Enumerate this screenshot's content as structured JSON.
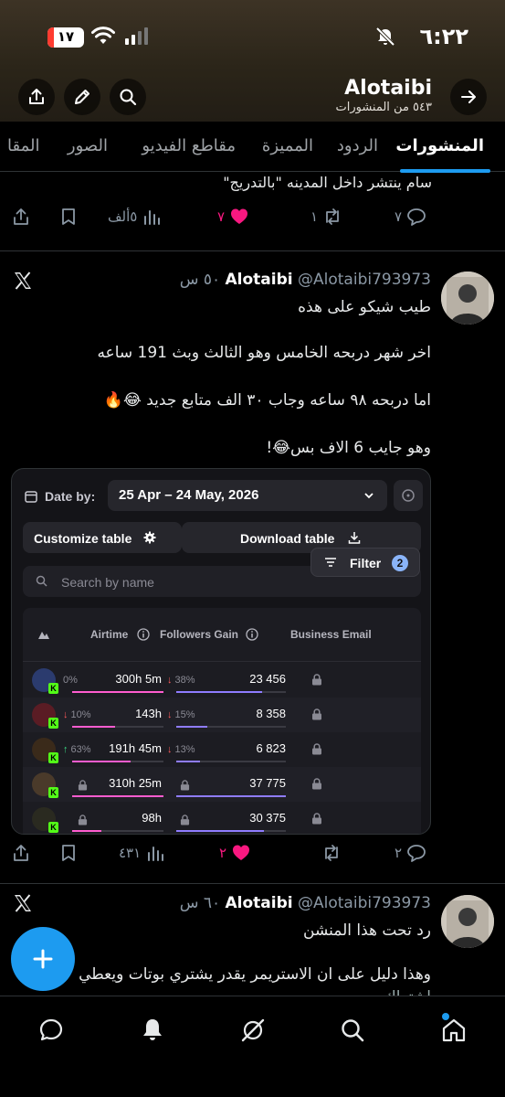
{
  "status_bar": {
    "time": "٦:٢٢",
    "battery_level": "١٧",
    "battery_fraction": 0.17
  },
  "profile": {
    "name": "Alotaibi",
    "post_count": "٥٤٣ من المنشورات"
  },
  "tabs": [
    {
      "label": "المنشورات",
      "active": true
    },
    {
      "label": "الردود",
      "active": false
    },
    {
      "label": "المميزة",
      "active": false
    },
    {
      "label": "مقاطع الفيديو",
      "active": false
    },
    {
      "label": "الصور",
      "active": false
    },
    {
      "label": "المقا",
      "active": false
    }
  ],
  "previous_post": {
    "tail_text": "سام ينتشر داخل المدينه \"بالتدريج\"",
    "replies": "٧",
    "reposts": "١",
    "likes": "٧",
    "views": "٥ألف"
  },
  "post1": {
    "author_name": "Alotaibi",
    "handle_time": "@Alotaibi793973 ٥٠ س",
    "lines": [
      "طيب شيكو على هذه",
      "اخر شهر دربحه الخامس وهو الثالث وبث 191 ساعه",
      "اما دربحه ٩٨ ساعه وجاب ٣٠ الف متابع جديد 😂🔥",
      "وهو جايب 6 الاف بس😂!"
    ],
    "replies": "٢",
    "likes": "٢",
    "views": "٤٣١"
  },
  "embedded_image": {
    "date_label": "Date by:",
    "date_range": "25 Apr – 24 May, 2026",
    "customize_label": "Customize table",
    "download_label": "Download table",
    "filter_label": "Filter",
    "filter_count": "2",
    "search_placeholder": "Search by name",
    "columns": {
      "airtime": "Airtime",
      "followers_gain": "Followers Gain",
      "business_email": "Business Email"
    },
    "rows": [
      {
        "airtime_change": "0%",
        "airtime": "300h 5m",
        "gain_change": "↓ 38%",
        "gain": "23 456",
        "airtime_fill": 1.0,
        "gain_fill": 0.78
      },
      {
        "airtime_change": "↓ 10%",
        "airtime": "143h",
        "gain_change": "↓ 15%",
        "gain": "8 358",
        "airtime_fill": 0.47,
        "gain_fill": 0.28
      },
      {
        "airtime_change": "↑ 63%",
        "airtime": "191h 45m",
        "gain_change": "↓ 13%",
        "gain": "6 823",
        "airtime_fill": 0.64,
        "gain_fill": 0.22
      },
      {
        "airtime_change": "",
        "airtime": "310h 25m",
        "gain_change": "",
        "gain": "37 775",
        "airtime_fill": 1.0,
        "gain_fill": 1.0
      },
      {
        "airtime_change": "",
        "airtime": "98h",
        "gain_change": "",
        "gain": "30 375",
        "airtime_fill": 0.32,
        "gain_fill": 0.8
      }
    ]
  },
  "post2": {
    "author_name": "Alotaibi",
    "handle_time": "@Alotaibi793973 ٦٠ س",
    "lines": [
      "رد تحت هذا المنشن",
      "وهذا دليل على ان الاستريمر يقدر يشتري بوتات ويعطي",
      "اشتراك"
    ]
  },
  "colors": {
    "accent": "#1d9bf0",
    "like": "#f91880",
    "kick_green": "#53fc18"
  }
}
